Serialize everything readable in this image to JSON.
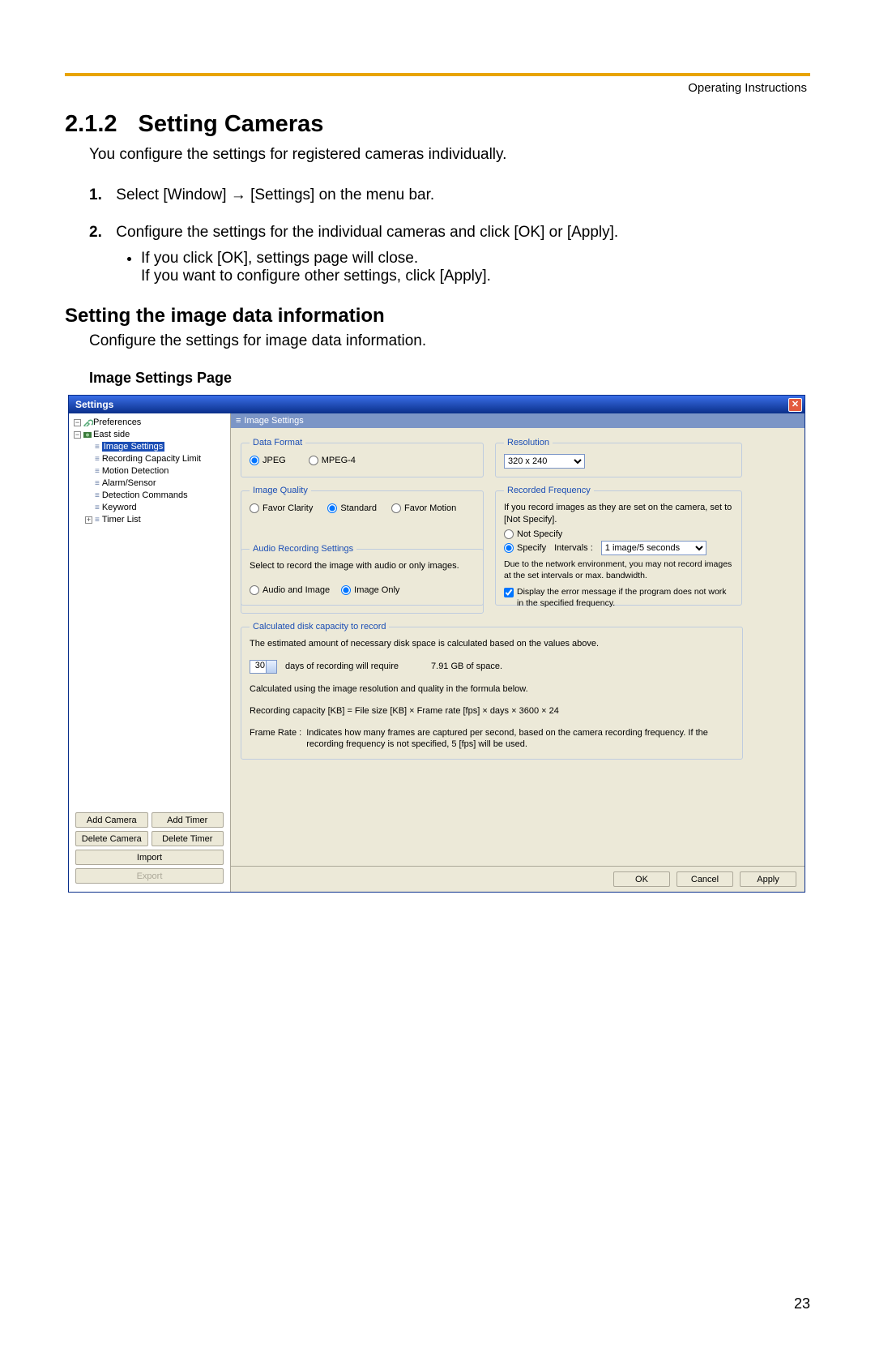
{
  "header": {
    "label": "Operating Instructions"
  },
  "section": {
    "number": "2.1.2",
    "title": "Setting Cameras",
    "intro": "You configure the settings for registered cameras individually."
  },
  "steps": {
    "s1": {
      "num": "1.",
      "before": "Select [Window]",
      "after": "[Settings] on the menu bar."
    },
    "s2": {
      "num": "2.",
      "text": "Configure the settings for the individual cameras and click [OK] or [Apply].",
      "bullet1": "If you click [OK], settings page will close.",
      "bullet1b": "If you want to configure other settings, click [Apply]."
    }
  },
  "subsection": {
    "title": "Setting the image data information",
    "intro": "Configure the settings for image data information.",
    "figure_label": "Image Settings Page"
  },
  "dialog": {
    "title": "Settings",
    "tree": {
      "preferences": "Preferences",
      "camera": "East side",
      "image_settings": "Image Settings",
      "recording_capacity": "Recording Capacity Limit",
      "motion_detection": "Motion Detection",
      "alarm_sensor": "Alarm/Sensor",
      "detection_commands": "Detection Commands",
      "keyword": "Keyword",
      "timer_list": "Timer List"
    },
    "side_buttons": {
      "add_camera": "Add Camera",
      "add_timer": "Add Timer",
      "delete_camera": "Delete Camera",
      "delete_timer": "Delete Timer",
      "import": "Import",
      "export": "Export"
    },
    "panel": {
      "title": "Image Settings"
    },
    "data_format": {
      "legend": "Data Format",
      "jpeg": "JPEG",
      "mpeg4": "MPEG-4"
    },
    "resolution": {
      "legend": "Resolution",
      "value": "320 x 240"
    },
    "image_quality": {
      "legend": "Image Quality",
      "clarity": "Favor Clarity",
      "standard": "Standard",
      "motion": "Favor Motion"
    },
    "recorded_frequency": {
      "legend": "Recorded Frequency",
      "line1": "If you record images as they are set on the camera, set to [Not Specify].",
      "not_specify": "Not Specify",
      "specify": "Specify",
      "intervals_label": "Intervals :",
      "intervals_value": "1 image/5 seconds",
      "warn": "Due to the network environment, you may not record images at the set intervals or max. bandwidth.",
      "display_err": "Display the error message if the program does not work in the specified frequency."
    },
    "audio": {
      "legend": "Audio Recording Settings",
      "hint": "Select to record the image with audio or only images.",
      "audio_image": "Audio and Image",
      "image_only": "Image Only"
    },
    "calc": {
      "legend": "Calculated disk capacity to record",
      "line1": "The estimated amount of necessary disk space is calculated based on the values above.",
      "days_value": "30",
      "days_text": "days of recording will require",
      "space_value": "7.91 GB of space.",
      "line3": "Calculated using the image resolution and quality in the formula below.",
      "formula": "Recording capacity [KB] = File size [KB] × Frame rate [fps] × days × 3600 × 24",
      "frame_rate_label": "Frame Rate :",
      "frame_rate_text": "Indicates how many frames are captured per second, based on the camera recording frequency. If the recording frequency is not specified, 5 [fps] will be used."
    },
    "footer": {
      "ok": "OK",
      "cancel": "Cancel",
      "apply": "Apply"
    }
  },
  "page_number": "23"
}
